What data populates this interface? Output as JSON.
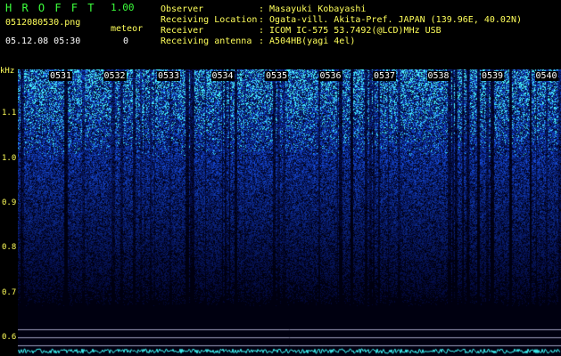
{
  "app": {
    "title": "H R O F F T",
    "version": "1.00",
    "filename": "0512080530.png",
    "mode": "meteor",
    "datetime": "05.12.08 05:30",
    "meteor_count": "0"
  },
  "info": {
    "rows": [
      {
        "label": "Observer",
        "value": ": Masayuki Kobayashi"
      },
      {
        "label": "Receiving Location",
        "value": ": Ogata-vill. Akita-Pref. JAPAN (139.96E, 40.02N)"
      },
      {
        "label": "Receiver",
        "value": ": ICOM IC-575 53.7492(@LCD)MHz USB"
      },
      {
        "label": "Receiving antenna",
        "value": ": A504HB(yagi 4el)"
      }
    ]
  },
  "axis": {
    "unit": "kHz",
    "ticks": [
      {
        "label": "1.1",
        "value": 1.1
      },
      {
        "label": "1.0",
        "value": 1.0
      },
      {
        "label": "0.9",
        "value": 0.9
      },
      {
        "label": "0.8",
        "value": 0.8
      },
      {
        "label": "0.7",
        "value": 0.7
      },
      {
        "label": "0.6",
        "value": 0.6
      }
    ],
    "range": [
      0.56,
      1.2
    ]
  },
  "time_marks": [
    "0531",
    "0532",
    "0533",
    "0534",
    "0535",
    "0536",
    "0537",
    "0538",
    "0539",
    "0540"
  ],
  "colors": {
    "title_green": "#3cff3c",
    "label_yellow": "#ffff5a",
    "noise_blue": "#1030ff",
    "signal_cyan": "#40ffff"
  }
}
